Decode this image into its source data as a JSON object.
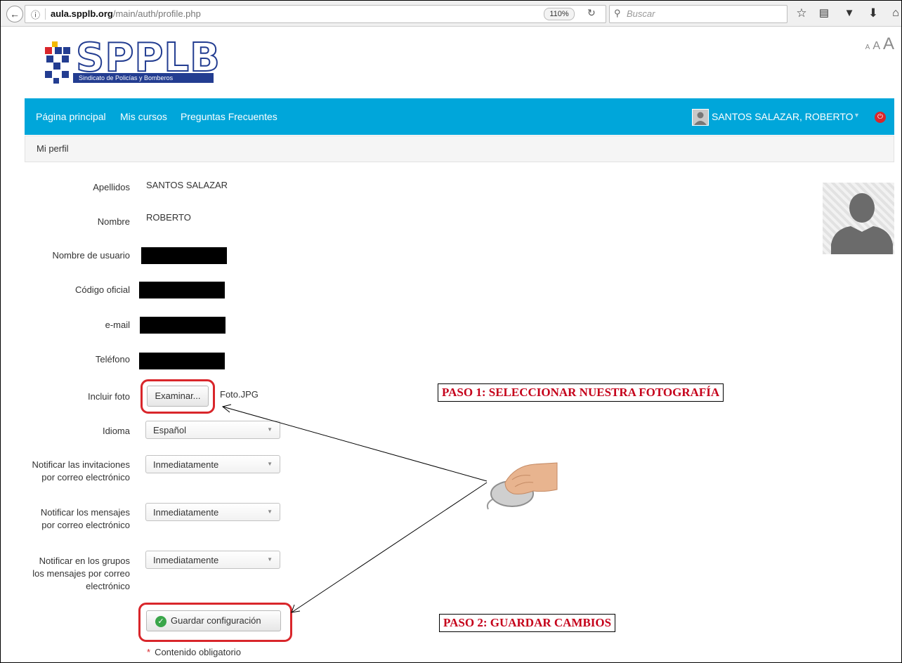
{
  "browser": {
    "url_host": "aula.spplb.org",
    "url_path": "/main/auth/profile.php",
    "zoom": "110%",
    "search_placeholder": "Buscar"
  },
  "site": {
    "logo_text": "SPPLB",
    "logo_subtitle": "Sindicato de Policías y Bomberos",
    "font_size_small": "A",
    "font_size_medium": "A",
    "font_size_large": "A"
  },
  "nav": {
    "items": [
      "Página principal",
      "Mis cursos",
      "Preguntas Frecuentes"
    ],
    "user_name": "SANTOS SALAZAR, ROBERTO"
  },
  "breadcrumb": "Mi perfil",
  "profile": {
    "apellidos_label": "Apellidos",
    "apellidos_value": "SANTOS SALAZAR",
    "nombre_label": "Nombre",
    "nombre_value": "ROBERTO",
    "usuario_label": "Nombre de usuario",
    "codigo_label": "Código oficial",
    "email_label": "e-mail",
    "telefono_label": "Teléfono",
    "foto_label": "Incluir foto",
    "examinar_label": "Examinar...",
    "foto_file": "Foto.JPG",
    "idioma_label": "Idioma",
    "idioma_value": "Español",
    "notif_invit_label_1": "Notificar las invitaciones",
    "notif_invit_label_2": "por correo electrónico",
    "notif_invit_value": "Inmediatamente",
    "notif_msg_label_1": "Notificar los mensajes",
    "notif_msg_label_2": "por correo electrónico",
    "notif_msg_value": "Inmediatamente",
    "notif_grp_label_1": "Notificar en los grupos",
    "notif_grp_label_2": "los mensajes por correo",
    "notif_grp_label_3": "electrónico",
    "notif_grp_value": "Inmediatamente",
    "save_label": "Guardar configuración",
    "required_note": "Contenido obligatorio"
  },
  "annotations": {
    "step1": "PASO 1: SELECCIONAR NUESTRA FOTOGRAFÍA",
    "step2": "PASO 2: GUARDAR CAMBIOS"
  },
  "colors": {
    "nav_bg": "#00a6da",
    "callout_red": "#c5001a",
    "logo_blue": "#233d91"
  }
}
